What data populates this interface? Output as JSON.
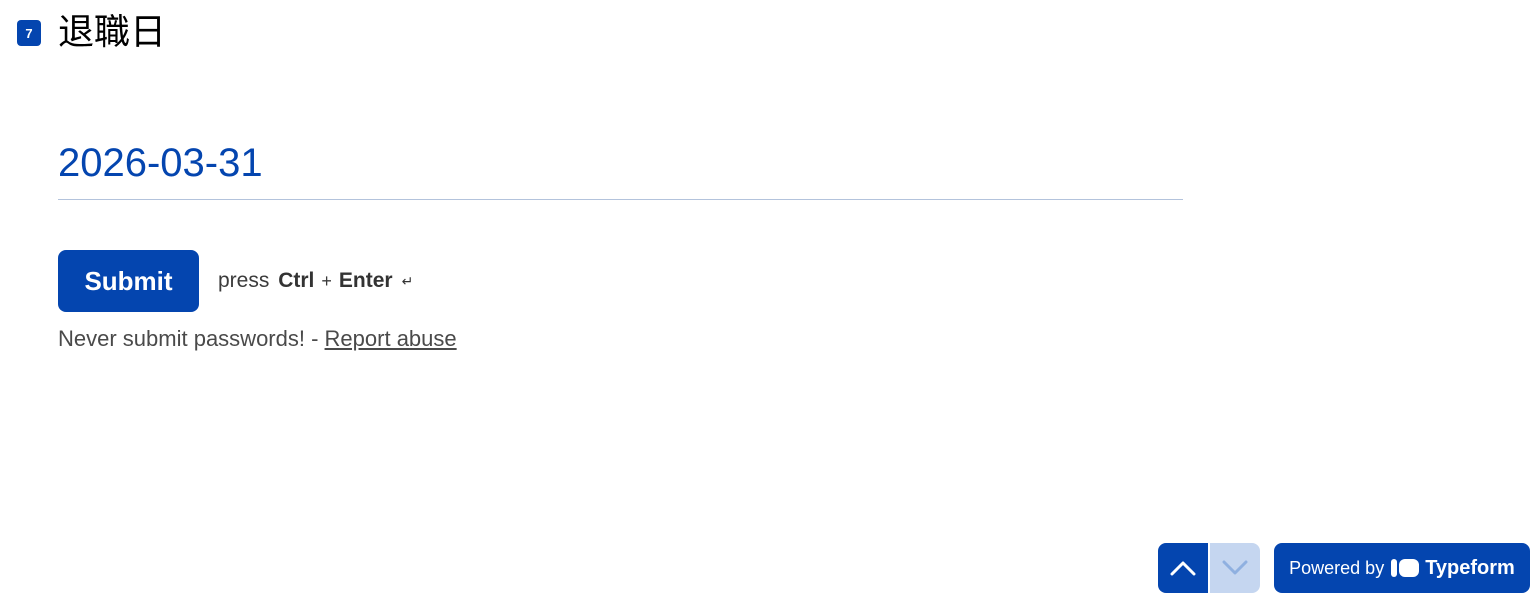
{
  "question": {
    "number": "7",
    "title": "退職日"
  },
  "date_input": {
    "value": "2026-03-31"
  },
  "submit": {
    "label": "Submit",
    "hint_press": "press",
    "hint_key1": "Ctrl",
    "hint_plus": "+",
    "hint_key2": "Enter",
    "enter_glyph": "↵"
  },
  "footer_note": {
    "text": "Never submit passwords! -",
    "link": "Report abuse"
  },
  "navigation": {
    "up_icon": "chevron-up-icon",
    "down_icon": "chevron-down-icon"
  },
  "powered_by": {
    "prefix": "Powered by",
    "brand": "Typeform"
  },
  "colors": {
    "accent": "#0445AF",
    "accent_light": "#c5d6f0",
    "underline": "#b3c3dc"
  }
}
